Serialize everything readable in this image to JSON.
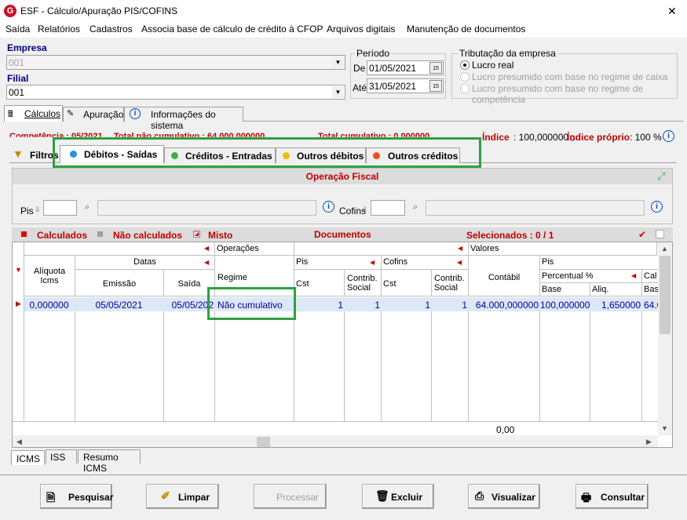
{
  "window": {
    "title": "ESF - Cálculo/Apuração PIS/COFINS",
    "close": "✕"
  },
  "menu": [
    "Saída",
    "Relatórios",
    "Cadastros",
    "Associa base de cálculo de crédito à CFOP",
    "Arquivos digitais",
    "Manutenção de documentos"
  ],
  "empresa": {
    "label": "Empresa",
    "value": "001"
  },
  "filial": {
    "label": "Filial",
    "value": "001"
  },
  "periodo": {
    "label": "Período",
    "de_label": "De",
    "de": "01/05/2021",
    "ate_label": "Até",
    "ate": "31/05/2021"
  },
  "tributacao": {
    "label": "Tributação da empresa",
    "options": [
      "Lucro real",
      "Lucro presumido com base no regime de caixa",
      "Lucro presumido com base no regime de competência"
    ],
    "selected": 0
  },
  "tabs": [
    "Cálculos",
    "Apuração",
    "Informações do sistema"
  ],
  "info": {
    "competencia": "Competência : 05/2021",
    "total_nao": "Total não cumulativo : 64.000,000000",
    "total_cum": "Total cumulativo : 0,000000",
    "indice_label": "Índice",
    "indice_value": ": 100,000000 ;",
    "indice_proprio_label": "Índice próprio",
    "indice_proprio_value": ": 100 %"
  },
  "subtabs": {
    "filtros": "Filtros",
    "items": [
      "Débitos - Saídas",
      "Créditos - Entradas",
      "Outros débitos",
      "Outros créditos"
    ]
  },
  "operacao": {
    "title": "Operação Fiscal",
    "pis_label": "Pis",
    "cofins_label": "Cofins"
  },
  "legend": {
    "calculados": "Calculados",
    "nao_calculados": "Não calculados",
    "misto": "Misto",
    "documentos": "Documentos",
    "selecionados": "Selecionados : 0 / 1"
  },
  "grid": {
    "aliquota": "Alíquota Icms",
    "datas": "Datas",
    "emissao": "Emissão",
    "saida": "Saída",
    "operacoes": "Operações",
    "regime": "Regime",
    "pis": "Pis",
    "cst": "Cst",
    "contrib": "Contrib. Social",
    "cofins": "Cofins",
    "valores": "Valores",
    "contabil": "Contábil",
    "percentual": "Percentual %",
    "base": "Base",
    "aliq": "Aliq.",
    "cal": "Cal",
    "bas": "Bas",
    "row": {
      "aliquota": "0,000000",
      "emissao": "05/05/2021",
      "saida": "05/05/202",
      "regime": "Não cumulativo",
      "pis_cst": "1",
      "pis_contrib": "1",
      "cof_cst": "1",
      "cof_contrib": "1",
      "contabil": "64.000,000000",
      "base": "100,000000",
      "aliq": "1,650000",
      "bas": "64.0"
    },
    "total": "0,00"
  },
  "bottom_tabs": [
    "ICMS",
    "ISS",
    "Resumo ICMS"
  ],
  "buttons": {
    "pesquisar": "Pesquisar",
    "limpar": "Limpar",
    "processar": "Processar",
    "excluir": "Excluir",
    "visualizar": "Visualizar",
    "consultar": "Consultar"
  }
}
